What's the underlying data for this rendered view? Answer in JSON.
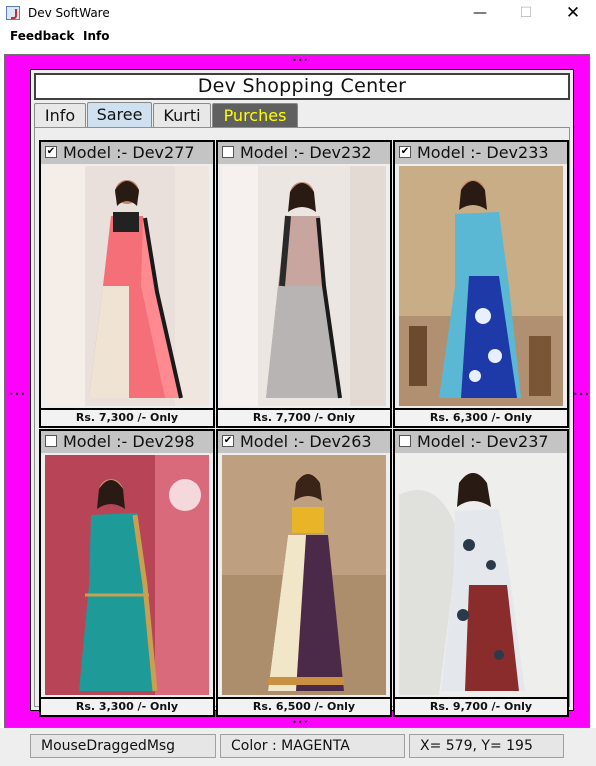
{
  "window": {
    "title": "Dev SoftWare",
    "minimize": "—",
    "maximize": "☐",
    "close": "✕",
    "icon": "java-cup-icon"
  },
  "menu": {
    "items": [
      "Feedback",
      "Info"
    ]
  },
  "colors": {
    "frame": "#ff00ff",
    "purchase_tab_text": "#ffff00",
    "purchase_tab_bg": "#606060",
    "selected_tab_bg": "#cfe0f0"
  },
  "header": {
    "title": "Dev Shopping Center"
  },
  "tabs": [
    {
      "label": "Info",
      "selected": false
    },
    {
      "label": "Saree",
      "selected": true
    },
    {
      "label": "Kurti",
      "selected": false
    },
    {
      "label": "Purches",
      "selected": false
    }
  ],
  "products": [
    {
      "title": "Model :- Dev277",
      "checked": true,
      "price": "Rs. 7,300 /- Only"
    },
    {
      "title": "Model :- Dev232",
      "checked": false,
      "price": "Rs. 7,700 /- Only"
    },
    {
      "title": "Model :- Dev233",
      "checked": true,
      "price": "Rs. 6,300 /- Only"
    },
    {
      "title": "Model :- Dev298",
      "checked": false,
      "price": "Rs. 3,300 /- Only"
    },
    {
      "title": "Model :- Dev263",
      "checked": true,
      "price": "Rs. 6,500 /- Only"
    },
    {
      "title": "Model :- Dev237",
      "checked": false,
      "price": "Rs. 9,700 /- Only"
    }
  ],
  "status": {
    "message": "MouseDraggedMsg",
    "color": "Color : MAGENTA",
    "coords": "X= 579, Y= 195"
  }
}
